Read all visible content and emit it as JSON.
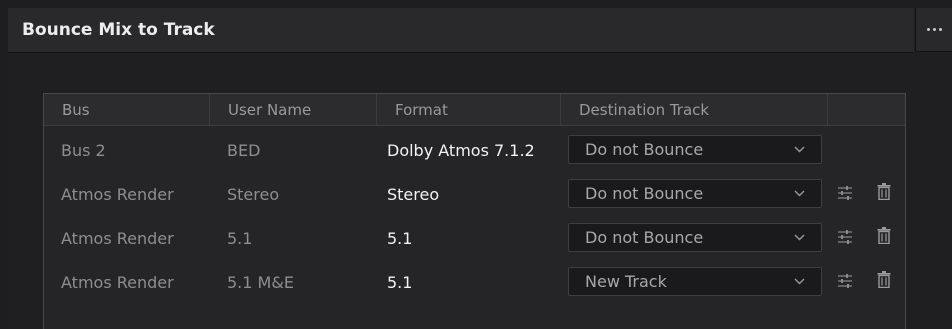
{
  "window": {
    "title": "Bounce Mix to Track",
    "more_icon": "more-horizontal-icon"
  },
  "table": {
    "columns": [
      "Bus",
      "User Name",
      "Format",
      "Destination Track",
      ""
    ],
    "rows": [
      {
        "bus": "Bus 2",
        "user_name": "BED",
        "format": "Dolby Atmos 7.1.2",
        "destination": "Do not Bounce",
        "has_actions": false
      },
      {
        "bus": "Atmos Render",
        "user_name": "Stereo",
        "format": "Stereo",
        "destination": "Do not Bounce",
        "has_actions": true
      },
      {
        "bus": "Atmos Render",
        "user_name": "5.1",
        "format": "5.1",
        "destination": "Do not Bounce",
        "has_actions": true
      },
      {
        "bus": "Atmos Render",
        "user_name": "5.1 M&E",
        "format": "5.1",
        "destination": "New Track",
        "has_actions": true
      }
    ]
  },
  "icons": {
    "dropdown": "chevron-down-icon",
    "settings": "sliders-icon",
    "delete": "trash-icon"
  },
  "colors": {
    "background": "#1e1e20",
    "titlebar": "#29292b",
    "text_primary": "#f2f2f2",
    "text_secondary": "#8e8e8e"
  }
}
